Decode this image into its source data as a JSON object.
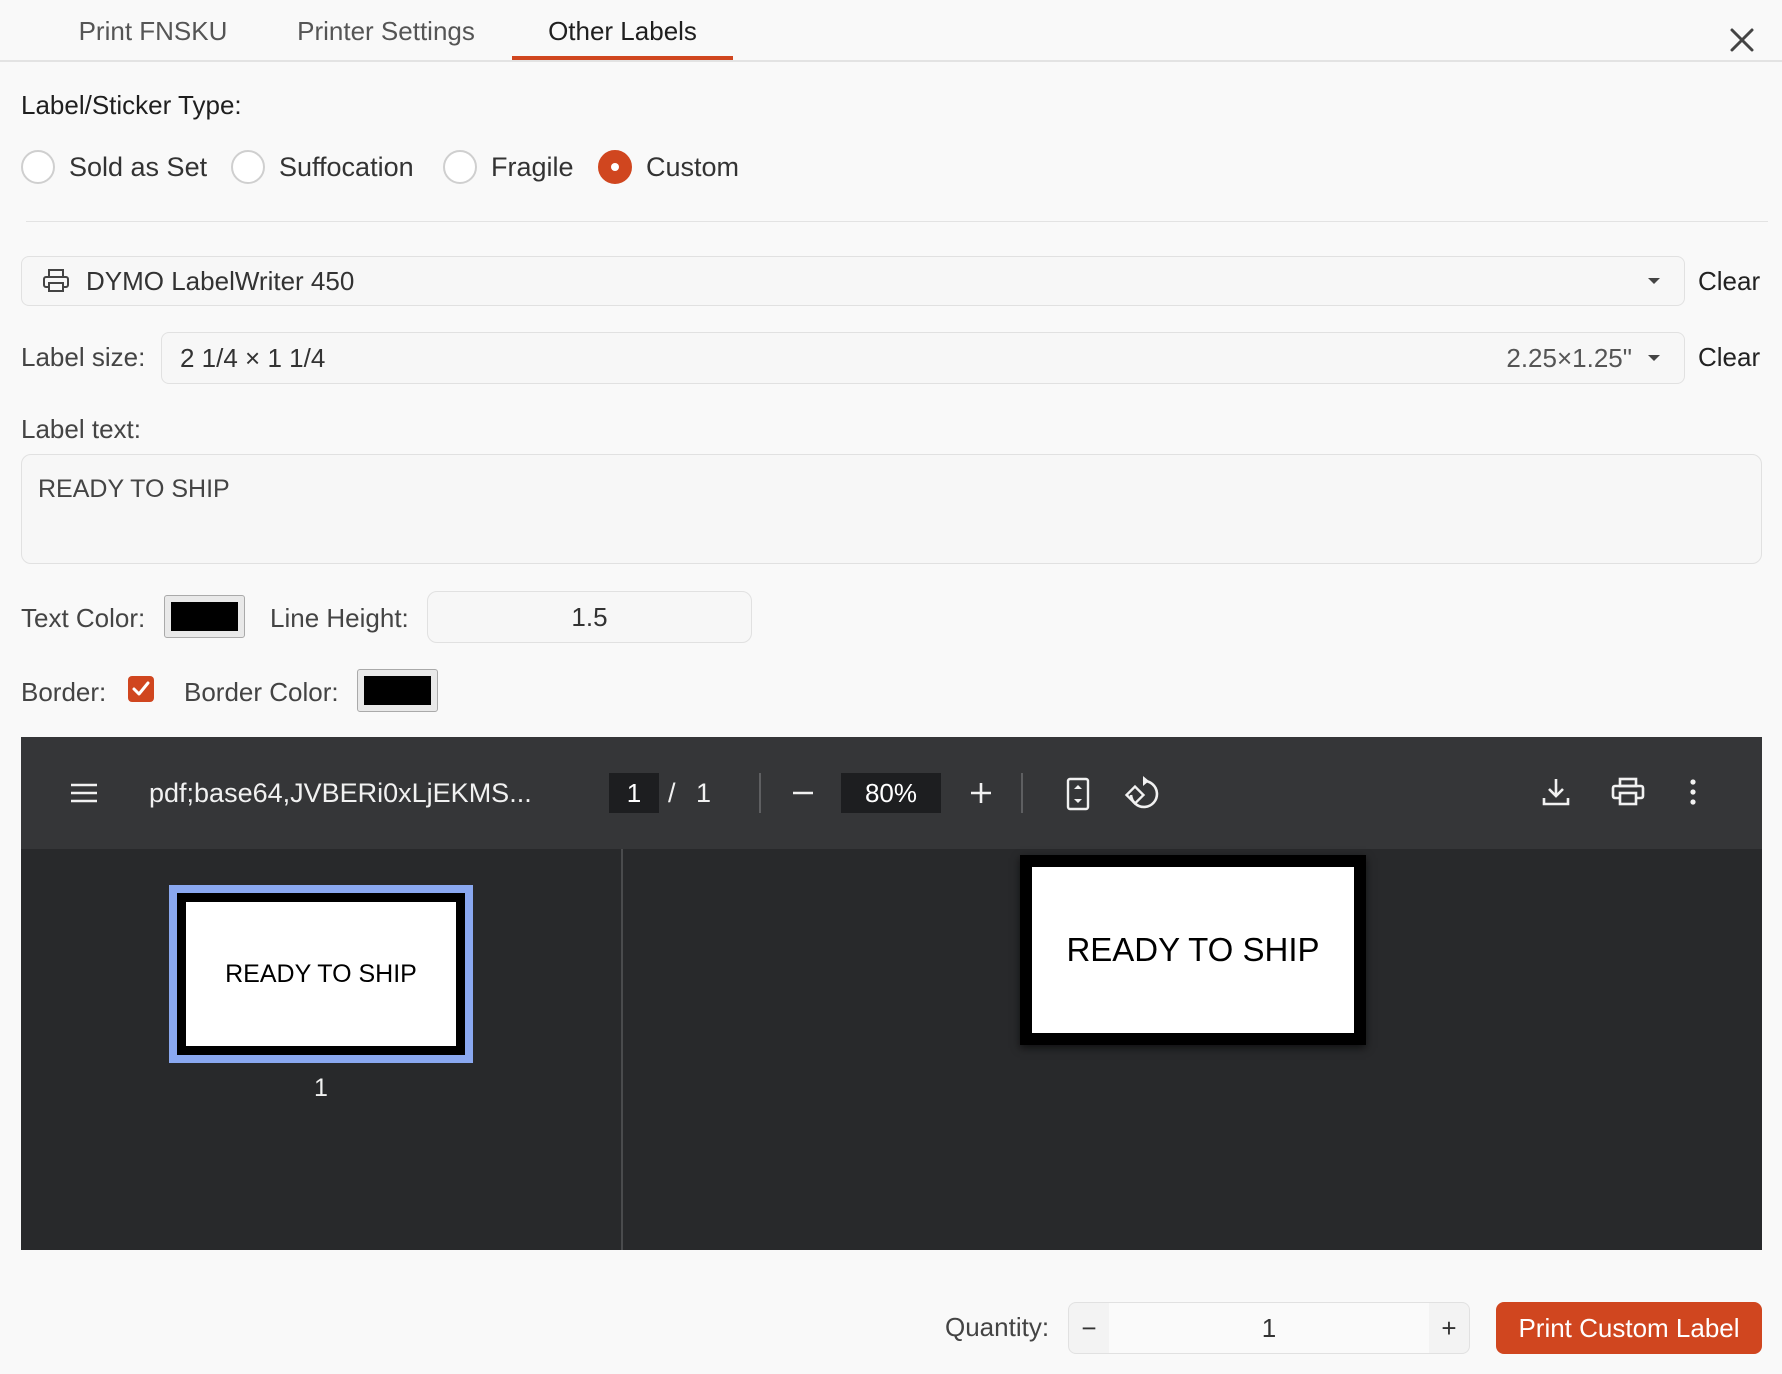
{
  "tabs": [
    {
      "label": "Print FNSKU",
      "active": false
    },
    {
      "label": "Printer Settings",
      "active": false
    },
    {
      "label": "Other Labels",
      "active": true
    }
  ],
  "section_title": "Label/Sticker Type:",
  "label_types": [
    {
      "label": "Sold as Set",
      "checked": false
    },
    {
      "label": "Suffocation",
      "checked": false
    },
    {
      "label": "Fragile",
      "checked": false
    },
    {
      "label": "Custom",
      "checked": true
    }
  ],
  "printer": {
    "value": "DYMO LabelWriter 450",
    "clear_label": "Clear"
  },
  "label_size": {
    "label": "Label size:",
    "value": "2 1/4 × 1 1/4",
    "dims": "2.25×1.25\"",
    "clear_label": "Clear"
  },
  "label_text": {
    "label": "Label text:",
    "value": "READY TO SHIP"
  },
  "text_color": {
    "label": "Text Color:",
    "value": "#000000"
  },
  "line_height": {
    "label": "Line Height:",
    "value": "1.5"
  },
  "border": {
    "label": "Border:",
    "checked": true
  },
  "border_color": {
    "label": "Border Color:",
    "value": "#000000"
  },
  "pdf_viewer": {
    "filename": "pdf;base64,JVBERi0xLjEKMS...",
    "current_page": "1",
    "page_sep": "/",
    "total_pages": "1",
    "zoom": "80%",
    "thumbnail_text": "READY TO SHIP",
    "thumbnail_page": "1",
    "page_text": "READY TO SHIP"
  },
  "quantity": {
    "label": "Quantity:",
    "value": "1",
    "minus": "−",
    "plus": "+"
  },
  "print_button": "Print Custom Label",
  "colors": {
    "accent": "#d0461f",
    "viewer_bg": "#28292b",
    "viewer_toolbar": "#353638",
    "thumb_highlight": "#8aa8f0"
  }
}
